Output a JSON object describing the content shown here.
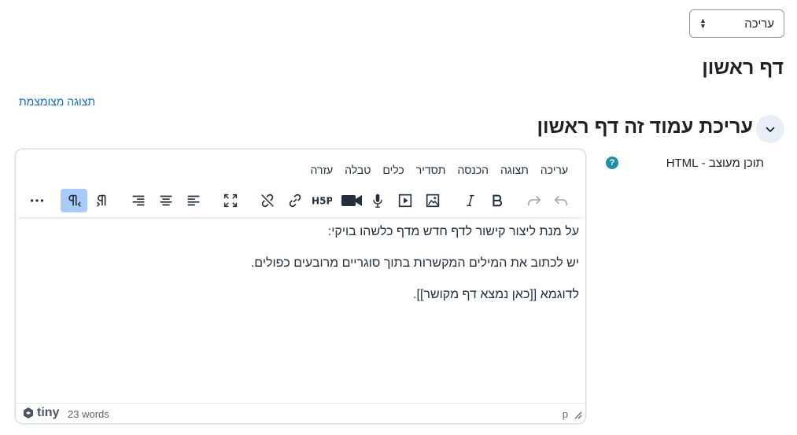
{
  "mode_select": {
    "value": "עריכה"
  },
  "page_title": "דף ראשון",
  "compact_link": "תצוגה מצומצמת",
  "section_heading": "עריכת עמוד זה דף ראשון",
  "field": {
    "label": "תוכן מעוצב - HTML",
    "help": "?"
  },
  "editor": {
    "menubar": [
      "עריכה",
      "תצוגה",
      "הכנסה",
      "תסדיר",
      "כלים",
      "טבלה",
      "עזרה"
    ],
    "toolbar_icons": [
      "undo-icon",
      "redo-icon",
      "bold-icon",
      "italic-icon",
      "image-icon",
      "media-icon",
      "record-audio-icon",
      "record-video-icon",
      "h5p-icon",
      "link-icon",
      "unlink-icon",
      "fullscreen-icon",
      "align-left-icon",
      "align-center-icon",
      "align-right-icon",
      "ltr-icon",
      "rtl-icon",
      "more-icon"
    ],
    "content": [
      "על מנת ליצור קישור לדף חדש מדף כלשהו בויקי:",
      "יש לכתוב את המילים המקשרות בתוך סוגריים מרובעים כפולים.",
      "לדוגמא [[כאן נמצא דף מקושר]]."
    ],
    "status": {
      "logo": "tiny",
      "word_count": "23 words",
      "path": "p"
    }
  },
  "colors": {
    "link": "#0f6cbf",
    "help": "#1f8fa6",
    "active_button": "#a6ccf7"
  }
}
